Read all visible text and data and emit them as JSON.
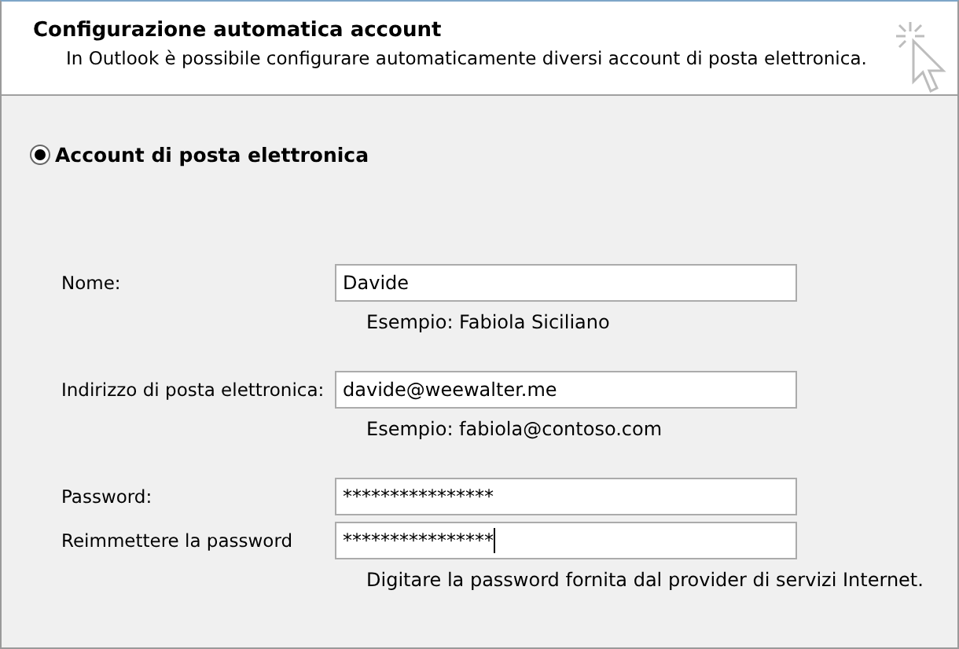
{
  "header": {
    "title": "Configurazione automatica account",
    "subtitle": "In Outlook è possibile configurare automaticamente diversi account di posta elettronica."
  },
  "options": [
    {
      "label": "Account di posta elettronica",
      "selected": true
    }
  ],
  "fields": [
    {
      "label": "Nome:",
      "value": "Davide",
      "focused": false,
      "hint": "Esempio: Fabiola Siciliano"
    },
    {
      "label": "Indirizzo di posta elettronica:",
      "value": "davide@weewalter.me",
      "focused": false,
      "hint": "Esempio: fabiola@contoso.com"
    },
    {
      "label": "Password:",
      "value": "****************",
      "focused": false
    },
    {
      "label": "Reimmettere la password",
      "value": "****************",
      "focused": true,
      "hint": "Digitare la password fornita dal provider di servizi Internet."
    }
  ]
}
